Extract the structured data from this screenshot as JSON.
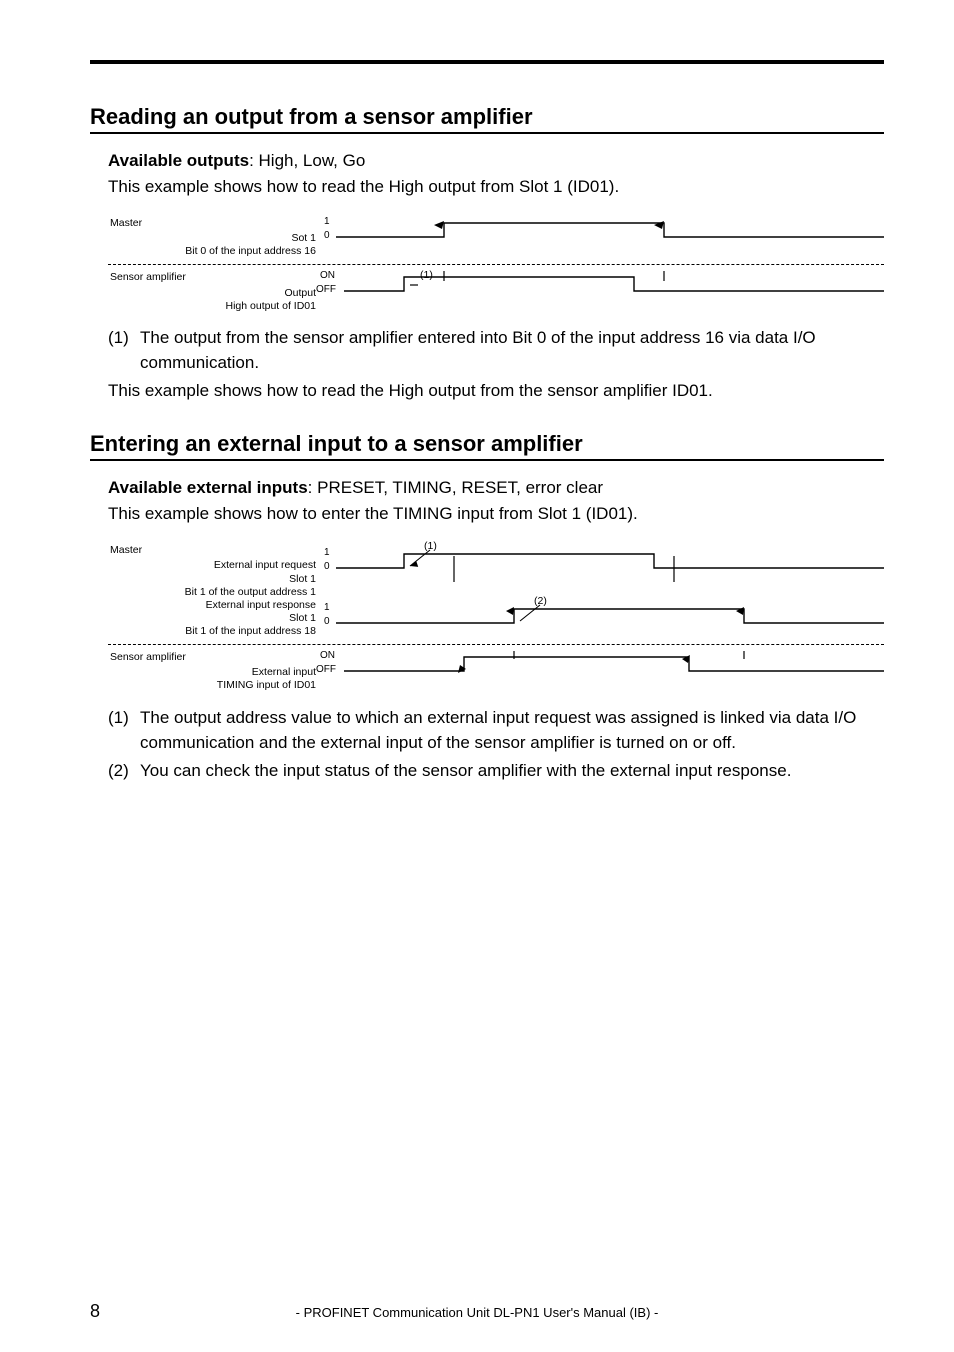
{
  "section1": {
    "heading": "Reading an output from a sensor amplifier",
    "available_label": "Available outputs",
    "available_values": ": High, Low, Go",
    "intro": "This example shows how to read the High output from Slot 1 (ID01).",
    "diagram": {
      "master_title": "Master",
      "master_line1": "Sot 1",
      "master_line2": "Bit 0 of the input address 16",
      "master_hi": "1",
      "master_lo": "0",
      "amp_title": "Sensor amplifier",
      "amp_line1": "Output",
      "amp_line2": "High output of ID01",
      "amp_hi": "ON",
      "amp_lo": "OFF",
      "callout1": "(1)"
    },
    "notes": [
      {
        "num": "(1)",
        "text": "The output from the sensor amplifier entered into Bit 0 of the input address 16 via data I/O communication."
      }
    ],
    "closing": "This example shows how to read the High output from the sensor amplifier ID01."
  },
  "section2": {
    "heading": "Entering an external input to a sensor amplifier",
    "available_label": "Available external inputs",
    "available_values": ": PRESET, TIMING, RESET, error clear",
    "intro": "This example shows how to enter the TIMING input from Slot 1 (ID01).",
    "diagram": {
      "master_title": "Master",
      "req_line1": "External input request",
      "req_line2": "Slot 1",
      "req_line3": "Bit 1 of the output address 1",
      "resp_line1": "External input response",
      "resp_line2": "Slot 1",
      "resp_line3": "Bit 1 of the input address 18",
      "hi": "1",
      "lo": "0",
      "amp_title": "Sensor amplifier",
      "amp_line1": "External input",
      "amp_line2": "TIMING input of ID01",
      "amp_hi": "ON",
      "amp_lo": "OFF",
      "callout1": "(1)",
      "callout2": "(2)"
    },
    "notes": [
      {
        "num": "(1)",
        "text": "The output address value to which an external input request was assigned is linked via data I/O communication and the external input of the sensor amplifier is turned on or off."
      },
      {
        "num": "(2)",
        "text": "You can check the input status of the sensor amplifier with the external input response."
      }
    ]
  },
  "footer": "- PROFINET Communication Unit DL-PN1 User's Manual (IB) -",
  "page_number": "8"
}
